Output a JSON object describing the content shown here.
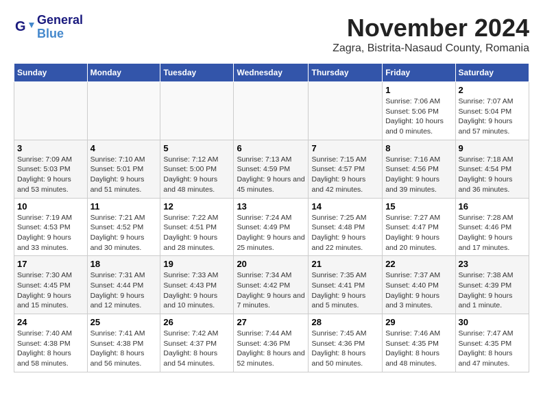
{
  "header": {
    "logo_line1": "General",
    "logo_line2": "Blue",
    "month_title": "November 2024",
    "location": "Zagra, Bistrita-Nasaud County, Romania"
  },
  "weekdays": [
    "Sunday",
    "Monday",
    "Tuesday",
    "Wednesday",
    "Thursday",
    "Friday",
    "Saturday"
  ],
  "weeks": [
    [
      {
        "day": "",
        "info": ""
      },
      {
        "day": "",
        "info": ""
      },
      {
        "day": "",
        "info": ""
      },
      {
        "day": "",
        "info": ""
      },
      {
        "day": "",
        "info": ""
      },
      {
        "day": "1",
        "info": "Sunrise: 7:06 AM\nSunset: 5:06 PM\nDaylight: 10 hours and 0 minutes."
      },
      {
        "day": "2",
        "info": "Sunrise: 7:07 AM\nSunset: 5:04 PM\nDaylight: 9 hours and 57 minutes."
      }
    ],
    [
      {
        "day": "3",
        "info": "Sunrise: 7:09 AM\nSunset: 5:03 PM\nDaylight: 9 hours and 53 minutes."
      },
      {
        "day": "4",
        "info": "Sunrise: 7:10 AM\nSunset: 5:01 PM\nDaylight: 9 hours and 51 minutes."
      },
      {
        "day": "5",
        "info": "Sunrise: 7:12 AM\nSunset: 5:00 PM\nDaylight: 9 hours and 48 minutes."
      },
      {
        "day": "6",
        "info": "Sunrise: 7:13 AM\nSunset: 4:59 PM\nDaylight: 9 hours and 45 minutes."
      },
      {
        "day": "7",
        "info": "Sunrise: 7:15 AM\nSunset: 4:57 PM\nDaylight: 9 hours and 42 minutes."
      },
      {
        "day": "8",
        "info": "Sunrise: 7:16 AM\nSunset: 4:56 PM\nDaylight: 9 hours and 39 minutes."
      },
      {
        "day": "9",
        "info": "Sunrise: 7:18 AM\nSunset: 4:54 PM\nDaylight: 9 hours and 36 minutes."
      }
    ],
    [
      {
        "day": "10",
        "info": "Sunrise: 7:19 AM\nSunset: 4:53 PM\nDaylight: 9 hours and 33 minutes."
      },
      {
        "day": "11",
        "info": "Sunrise: 7:21 AM\nSunset: 4:52 PM\nDaylight: 9 hours and 30 minutes."
      },
      {
        "day": "12",
        "info": "Sunrise: 7:22 AM\nSunset: 4:51 PM\nDaylight: 9 hours and 28 minutes."
      },
      {
        "day": "13",
        "info": "Sunrise: 7:24 AM\nSunset: 4:49 PM\nDaylight: 9 hours and 25 minutes."
      },
      {
        "day": "14",
        "info": "Sunrise: 7:25 AM\nSunset: 4:48 PM\nDaylight: 9 hours and 22 minutes."
      },
      {
        "day": "15",
        "info": "Sunrise: 7:27 AM\nSunset: 4:47 PM\nDaylight: 9 hours and 20 minutes."
      },
      {
        "day": "16",
        "info": "Sunrise: 7:28 AM\nSunset: 4:46 PM\nDaylight: 9 hours and 17 minutes."
      }
    ],
    [
      {
        "day": "17",
        "info": "Sunrise: 7:30 AM\nSunset: 4:45 PM\nDaylight: 9 hours and 15 minutes."
      },
      {
        "day": "18",
        "info": "Sunrise: 7:31 AM\nSunset: 4:44 PM\nDaylight: 9 hours and 12 minutes."
      },
      {
        "day": "19",
        "info": "Sunrise: 7:33 AM\nSunset: 4:43 PM\nDaylight: 9 hours and 10 minutes."
      },
      {
        "day": "20",
        "info": "Sunrise: 7:34 AM\nSunset: 4:42 PM\nDaylight: 9 hours and 7 minutes."
      },
      {
        "day": "21",
        "info": "Sunrise: 7:35 AM\nSunset: 4:41 PM\nDaylight: 9 hours and 5 minutes."
      },
      {
        "day": "22",
        "info": "Sunrise: 7:37 AM\nSunset: 4:40 PM\nDaylight: 9 hours and 3 minutes."
      },
      {
        "day": "23",
        "info": "Sunrise: 7:38 AM\nSunset: 4:39 PM\nDaylight: 9 hours and 1 minute."
      }
    ],
    [
      {
        "day": "24",
        "info": "Sunrise: 7:40 AM\nSunset: 4:38 PM\nDaylight: 8 hours and 58 minutes."
      },
      {
        "day": "25",
        "info": "Sunrise: 7:41 AM\nSunset: 4:38 PM\nDaylight: 8 hours and 56 minutes."
      },
      {
        "day": "26",
        "info": "Sunrise: 7:42 AM\nSunset: 4:37 PM\nDaylight: 8 hours and 54 minutes."
      },
      {
        "day": "27",
        "info": "Sunrise: 7:44 AM\nSunset: 4:36 PM\nDaylight: 8 hours and 52 minutes."
      },
      {
        "day": "28",
        "info": "Sunrise: 7:45 AM\nSunset: 4:36 PM\nDaylight: 8 hours and 50 minutes."
      },
      {
        "day": "29",
        "info": "Sunrise: 7:46 AM\nSunset: 4:35 PM\nDaylight: 8 hours and 48 minutes."
      },
      {
        "day": "30",
        "info": "Sunrise: 7:47 AM\nSunset: 4:35 PM\nDaylight: 8 hours and 47 minutes."
      }
    ]
  ]
}
